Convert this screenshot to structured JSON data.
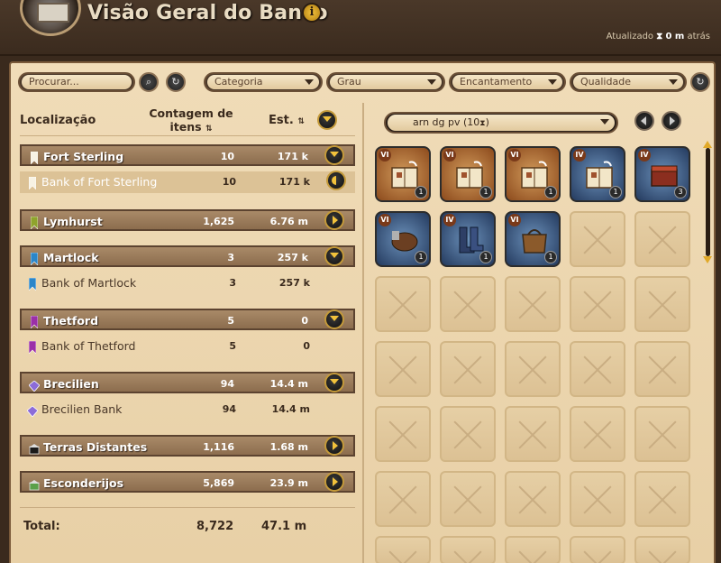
{
  "header": {
    "title": "Visão Geral do Banco",
    "info_icon": "i",
    "updated_label": "Atualizado",
    "updated_value": "0 m",
    "updated_suffix": "atrás"
  },
  "filters": {
    "search_placeholder": "Procurar...",
    "category": "Categoria",
    "tier": "Grau",
    "enchantment": "Encantamento",
    "quality": "Qualidade"
  },
  "columns": {
    "location": "Localização",
    "count": "Contagem de itens",
    "est": "Est."
  },
  "locations": [
    {
      "name": "Fort Sterling",
      "count": "10",
      "est": "171 k",
      "type": "city",
      "color": "#f7f2e4",
      "expanded": true
    },
    {
      "name": "Bank of Fort Sterling",
      "count": "10",
      "est": "171 k",
      "type": "bank",
      "color": "#f7f2e4",
      "selected": true
    },
    {
      "name": "Lymhurst",
      "count": "1,625",
      "est": "6.76 m",
      "type": "city",
      "color": "#8fa42c",
      "expanded": false
    },
    {
      "name": "Martlock",
      "count": "3",
      "est": "257 k",
      "type": "city",
      "color": "#2b86c9",
      "expanded": true
    },
    {
      "name": "Bank of Martlock",
      "count": "3",
      "est": "257 k",
      "type": "bank",
      "color": "#2b86c9"
    },
    {
      "name": "Thetford",
      "count": "5",
      "est": "0",
      "type": "city",
      "color": "#9b2fa8",
      "expanded": true
    },
    {
      "name": "Bank of Thetford",
      "count": "5",
      "est": "0",
      "type": "bank",
      "color": "#9b2fa8"
    },
    {
      "name": "Brecilien",
      "count": "94",
      "est": "14.4 m",
      "type": "city",
      "color": "#8c6cd8",
      "expanded": true
    },
    {
      "name": "Brecilien Bank",
      "count": "94",
      "est": "14.4 m",
      "type": "bank",
      "color": "#8c6cd8"
    },
    {
      "name": "Terras Distantes",
      "count": "1,116",
      "est": "1.68 m",
      "type": "city",
      "color": "#1a1a1a",
      "expanded": false
    },
    {
      "name": "Esconderijos",
      "count": "5,869",
      "est": "23.9 m",
      "type": "city",
      "color": "#5aa04a",
      "expanded": false
    }
  ],
  "total": {
    "label": "Total:",
    "count": "8,722",
    "est": "47.1 m"
  },
  "tab": {
    "label": "arn dg pv (10"
  },
  "items": [
    {
      "tier": "VI",
      "qty": "1",
      "style": "orange",
      "icon": "tome-icon"
    },
    {
      "tier": "VI",
      "qty": "1",
      "style": "orange",
      "icon": "tome-icon"
    },
    {
      "tier": "VI",
      "qty": "1",
      "style": "orange",
      "icon": "tome-icon"
    },
    {
      "tier": "IV",
      "qty": "1",
      "style": "blue",
      "icon": "tome-icon"
    },
    {
      "tier": "IV",
      "qty": "3",
      "style": "blue",
      "icon": "chest-icon"
    },
    {
      "tier": "VI",
      "qty": "1",
      "style": "blue",
      "icon": "mount-icon"
    },
    {
      "tier": "IV",
      "qty": "1",
      "style": "blue",
      "icon": "boots-icon"
    },
    {
      "tier": "VI",
      "qty": "1",
      "style": "blue",
      "icon": "bag-icon"
    }
  ]
}
